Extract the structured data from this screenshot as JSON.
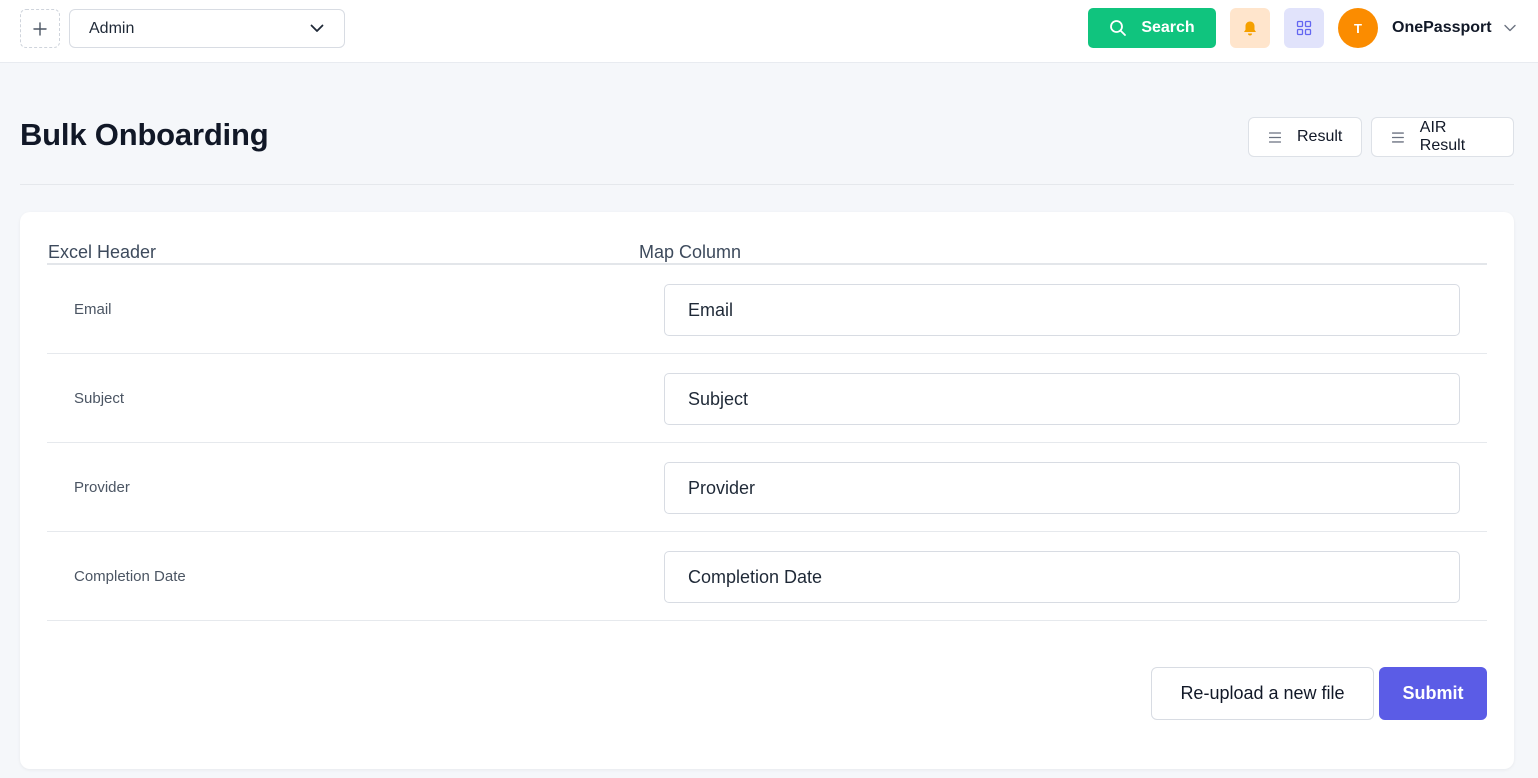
{
  "topbar": {
    "role_select": {
      "value": "Admin"
    },
    "search_label": "Search",
    "user": {
      "avatar_initial": "T",
      "name": "OnePassport"
    }
  },
  "page": {
    "title": "Bulk Onboarding",
    "header_buttons": {
      "result": "Result",
      "air_result": "AIR Result"
    }
  },
  "mapping_table": {
    "headers": {
      "excel_header": "Excel Header",
      "map_column": "Map Column"
    },
    "rows": [
      {
        "excel_header": "Email",
        "map_column": "Email"
      },
      {
        "excel_header": "Subject",
        "map_column": "Subject"
      },
      {
        "excel_header": "Provider",
        "map_column": "Provider"
      },
      {
        "excel_header": "Completion Date",
        "map_column": "Completion Date"
      }
    ]
  },
  "actions": {
    "reupload": "Re-upload a new file",
    "submit": "Submit"
  },
  "colors": {
    "search_green": "#10c47e",
    "submit_purple": "#5b5ce6",
    "avatar_orange": "#fb8c00",
    "bell_bg": "#ffe5cc",
    "bell_icon": "#f5a000",
    "apps_bg": "#e1e3fb"
  },
  "icons": {
    "plus": "plus-icon",
    "chevron": "chevron-down-icon",
    "search": "search-icon",
    "bell": "bell-icon",
    "apps": "grid-icon",
    "menu": "menu-lines-icon"
  }
}
